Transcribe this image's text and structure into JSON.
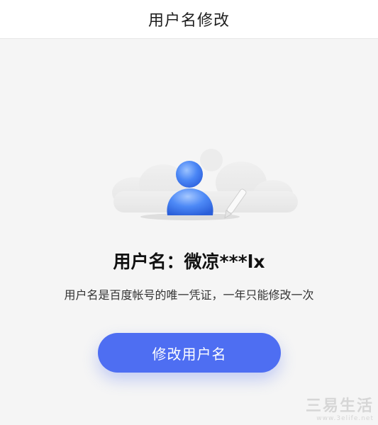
{
  "header": {
    "title": "用户名修改"
  },
  "profile": {
    "username_line": "用户名：微凉***lx",
    "description": "用户名是百度帐号的唯一凭证，一年只能修改一次",
    "illustration_icon": "user-edit-icon"
  },
  "actions": {
    "modify_label": "修改用户名"
  },
  "watermark": {
    "main": "三易生活",
    "sub": "www.3elife.net"
  },
  "colors": {
    "accent": "#4e6ef2",
    "avatar_blue": "#3f7bf0",
    "background": "#f5f5f5"
  }
}
